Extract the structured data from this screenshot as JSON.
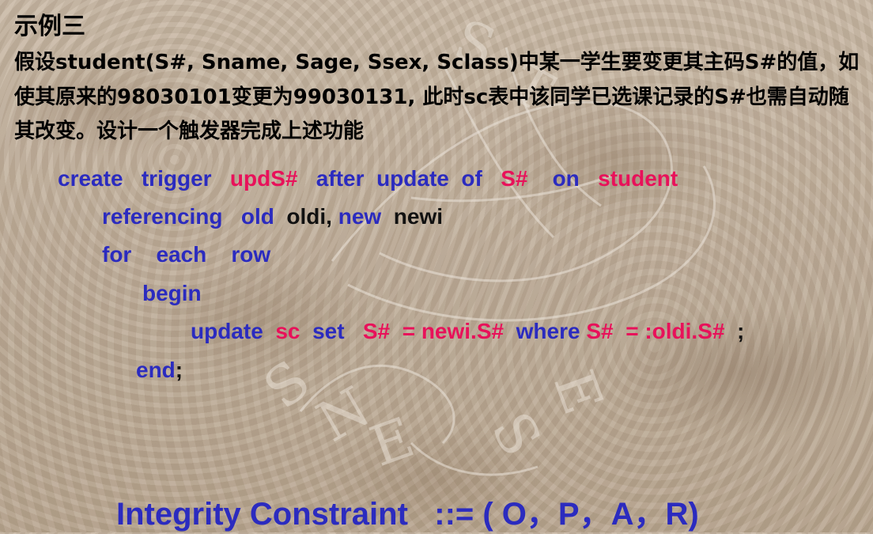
{
  "slide": {
    "title": "示例三",
    "paragraph": "假设student(S#, Sname, Sage, Ssex, Sclass)中某一学生要变更其主码S#的值，如使其原来的98030101变更为99030131, 此时sc表中该同学已选课记录的S#也需自动随其改变。设计一个触发器完成上述功能",
    "code": {
      "line1": {
        "create": "create",
        "trigger": "trigger",
        "name": "updS#",
        "after": "after",
        "update": "update",
        "of": "of",
        "col": "S#",
        "on": "on",
        "table": "student"
      },
      "line2": {
        "referencing": "referencing",
        "old": "old",
        "oldi": "oldi,",
        "new": "new",
        "newi": "newi"
      },
      "line3": {
        "for": "for",
        "each": "each",
        "row": "row"
      },
      "line4": {
        "begin": "begin"
      },
      "line5": {
        "update": "update",
        "sc": "sc",
        "set": "set",
        "col": "S#",
        "assign": "= newi.S#",
        "where": "where",
        "col2": "S#",
        "cond": "= :oldi.S#",
        "semi": ";"
      },
      "line6": {
        "end": "end",
        "semi": ";"
      }
    },
    "footer": "Integrity Constraint   ::= ( O，P，A，R)",
    "colors": {
      "keyword": "#2b2bbf",
      "highlight": "#e8115a",
      "text": "#000000"
    }
  }
}
